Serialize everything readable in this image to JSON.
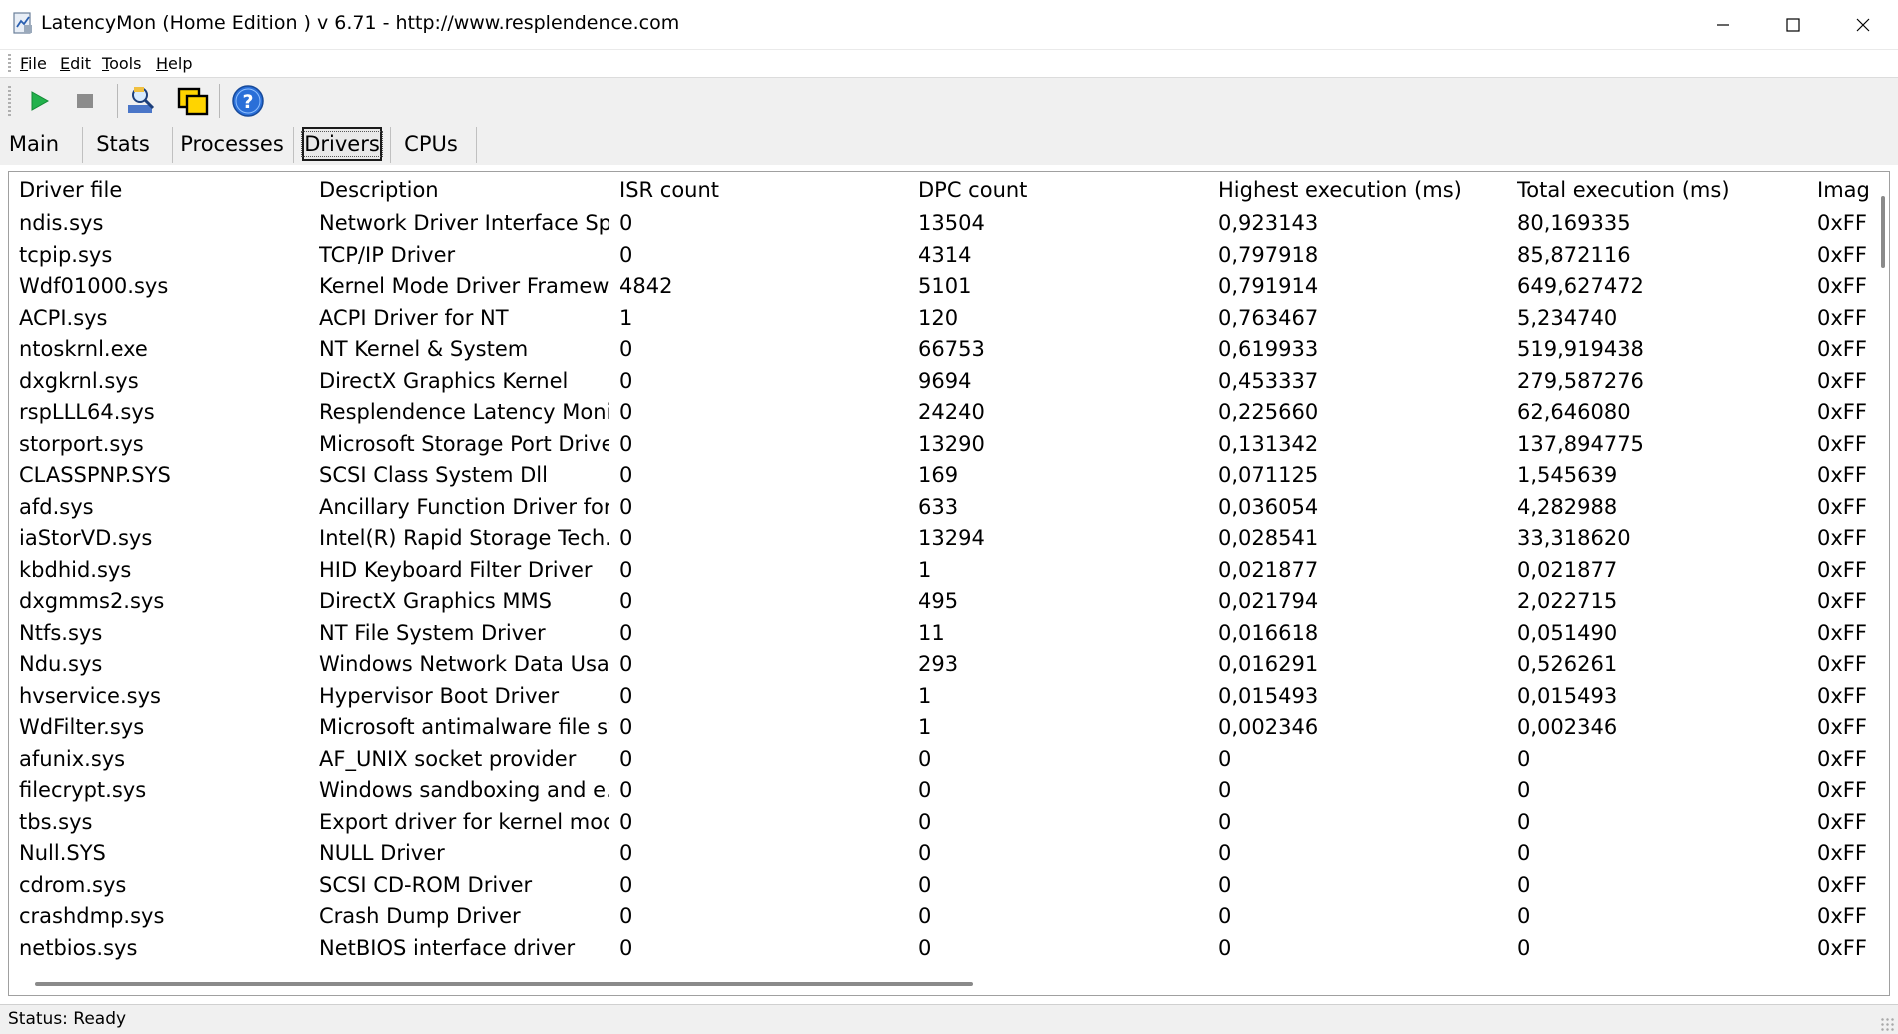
{
  "window": {
    "title": "LatencyMon  (Home Edition )  v 6.71 - http://www.resplendence.com",
    "minimize_icon": "minimize-icon",
    "maximize_icon": "maximize-icon",
    "close_icon": "close-icon"
  },
  "menu": {
    "items": [
      {
        "label": "File",
        "u": "F",
        "rest": "ile"
      },
      {
        "label": "Edit",
        "u": "E",
        "rest": "dit"
      },
      {
        "label": "Tools",
        "u": "T",
        "rest": "ools"
      },
      {
        "label": "Help",
        "u": "H",
        "rest": "elp"
      }
    ]
  },
  "toolbar": {
    "buttons": [
      "play-icon",
      "stop-icon",
      "search-tools-icon",
      "windows-icon",
      "help-icon"
    ],
    "colors": {
      "play": "#22b14c",
      "stop": "#8c8c8c",
      "help": "#2a6fd8"
    }
  },
  "tabs": [
    {
      "label": "Main",
      "active": false
    },
    {
      "label": "Stats",
      "active": false
    },
    {
      "label": "Processes",
      "active": false
    },
    {
      "label": "Drivers",
      "active": true
    },
    {
      "label": "CPUs",
      "active": false
    }
  ],
  "table": {
    "columns": [
      "Driver file",
      "Description",
      "ISR count",
      "DPC count",
      "Highest execution (ms)",
      "Total execution (ms)",
      "Imag"
    ],
    "rows": [
      [
        "ndis.sys",
        "Network Driver Interface Sp...",
        "0",
        "13504",
        "0,923143",
        "80,169335",
        "0xFF"
      ],
      [
        "tcpip.sys",
        "TCP/IP Driver",
        "0",
        "4314",
        "0,797918",
        "85,872116",
        "0xFF"
      ],
      [
        "Wdf01000.sys",
        "Kernel Mode Driver Framew...",
        "4842",
        "5101",
        "0,791914",
        "649,627472",
        "0xFF"
      ],
      [
        "ACPI.sys",
        "ACPI Driver for NT",
        "1",
        "120",
        "0,763467",
        "5,234740",
        "0xFF"
      ],
      [
        "ntoskrnl.exe",
        "NT Kernel & System",
        "0",
        "66753",
        "0,619933",
        "519,919438",
        "0xFF"
      ],
      [
        "dxgkrnl.sys",
        "DirectX Graphics Kernel",
        "0",
        "9694",
        "0,453337",
        "279,587276",
        "0xFF"
      ],
      [
        "rspLLL64.sys",
        "Resplendence Latency Monit...",
        "0",
        "24240",
        "0,225660",
        "62,646080",
        "0xFF"
      ],
      [
        "storport.sys",
        "Microsoft Storage Port Driver",
        "0",
        "13290",
        "0,131342",
        "137,894775",
        "0xFF"
      ],
      [
        "CLASSPNP.SYS",
        "SCSI Class System Dll",
        "0",
        "169",
        "0,071125",
        "1,545639",
        "0xFF"
      ],
      [
        "afd.sys",
        "Ancillary Function Driver for ...",
        "0",
        "633",
        "0,036054",
        "4,282988",
        "0xFF"
      ],
      [
        "iaStorVD.sys",
        "Intel(R) Rapid Storage Tech...",
        "0",
        "13294",
        "0,028541",
        "33,318620",
        "0xFF"
      ],
      [
        "kbdhid.sys",
        "HID Keyboard Filter Driver",
        "0",
        "1",
        "0,021877",
        "0,021877",
        "0xFF"
      ],
      [
        "dxgmms2.sys",
        "DirectX Graphics MMS",
        "0",
        "495",
        "0,021794",
        "2,022715",
        "0xFF"
      ],
      [
        "Ntfs.sys",
        "NT File System Driver",
        "0",
        "11",
        "0,016618",
        "0,051490",
        "0xFF"
      ],
      [
        "Ndu.sys",
        "Windows Network Data Usa...",
        "0",
        "293",
        "0,016291",
        "0,526261",
        "0xFF"
      ],
      [
        "hvservice.sys",
        "Hypervisor Boot Driver",
        "0",
        "1",
        "0,015493",
        "0,015493",
        "0xFF"
      ],
      [
        "WdFilter.sys",
        "Microsoft antimalware file sys...",
        "0",
        "1",
        "0,002346",
        "0,002346",
        "0xFF"
      ],
      [
        "afunix.sys",
        "AF_UNIX socket provider",
        "0",
        "0",
        "0",
        "0",
        "0xFF"
      ],
      [
        "filecrypt.sys",
        "Windows sandboxing and e...",
        "0",
        "0",
        "0",
        "0",
        "0xFF"
      ],
      [
        "tbs.sys",
        "Export driver for kernel mod...",
        "0",
        "0",
        "0",
        "0",
        "0xFF"
      ],
      [
        "Null.SYS",
        "NULL Driver",
        "0",
        "0",
        "0",
        "0",
        "0xFF"
      ],
      [
        "cdrom.sys",
        "SCSI CD-ROM Driver",
        "0",
        "0",
        "0",
        "0",
        "0xFF"
      ],
      [
        "crashdmp.sys",
        "Crash Dump Driver",
        "0",
        "0",
        "0",
        "0",
        "0xFF"
      ],
      [
        "netbios.sys",
        "NetBIOS interface driver",
        "0",
        "0",
        "0",
        "0",
        "0xFF"
      ]
    ]
  },
  "status": {
    "text": "Status: Ready"
  }
}
